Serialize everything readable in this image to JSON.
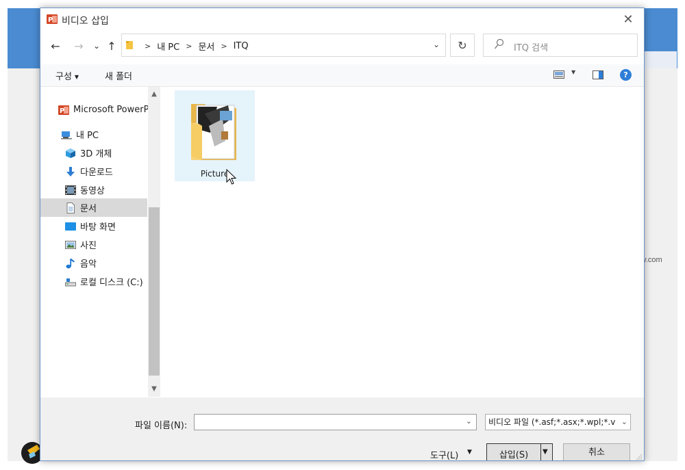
{
  "dialog": {
    "title": "비디오 삽입",
    "close_glyph": "✕"
  },
  "nav": {
    "back": "←",
    "forward": "→",
    "history": "⌄",
    "up": "↑",
    "breadcrumbs": [
      "내 PC",
      "문서",
      "ITQ"
    ],
    "breadcrumb_sep": ">",
    "address_dropdown": "⌄",
    "refresh": "↻",
    "search_placeholder": "ITQ 검색"
  },
  "toolbar": {
    "organize": "구성",
    "organize_caret": "▼",
    "new_folder": "새 폴더",
    "view_caret": "▼",
    "help": "?"
  },
  "navpane": {
    "items": [
      {
        "label": "Microsoft PowerP",
        "icon": "powerpoint-icon"
      },
      {
        "label": "내 PC",
        "icon": "pc-icon"
      },
      {
        "label": "3D 개체",
        "icon": "3d-objects-icon"
      },
      {
        "label": "다운로드",
        "icon": "download-icon"
      },
      {
        "label": "동영상",
        "icon": "video-icon"
      },
      {
        "label": "문서",
        "icon": "document-icon",
        "selected": true
      },
      {
        "label": "바탕 화면",
        "icon": "desktop-icon"
      },
      {
        "label": "사진",
        "icon": "pictures-icon"
      },
      {
        "label": "음악",
        "icon": "music-icon"
      },
      {
        "label": "로컬 디스크 (C:)",
        "icon": "drive-icon"
      }
    ],
    "scroll_up": "▲",
    "scroll_down": "▼"
  },
  "files": [
    {
      "name": "Picture",
      "icon": "folder-icon",
      "selected": true
    }
  ],
  "bottom": {
    "filename_label": "파일 이름(N):",
    "filename_value": "",
    "filename_dropdown": "⌄",
    "filetype": "비디오 파일 (*.asf;*.asx;*.wpl;*.v",
    "filetype_dropdown": "⌄",
    "tools": "도구(L)",
    "tools_caret": "▼",
    "insert": "삽입(S)",
    "insert_caret": "▼",
    "cancel": "취소"
  },
  "watermark": "shinyj-it.tistory.com",
  "colors": {
    "accent": "#4a8bd1",
    "selection": "#e5f3fb",
    "nav_selected": "#d9d9d9",
    "help": "#2f7ed8"
  }
}
